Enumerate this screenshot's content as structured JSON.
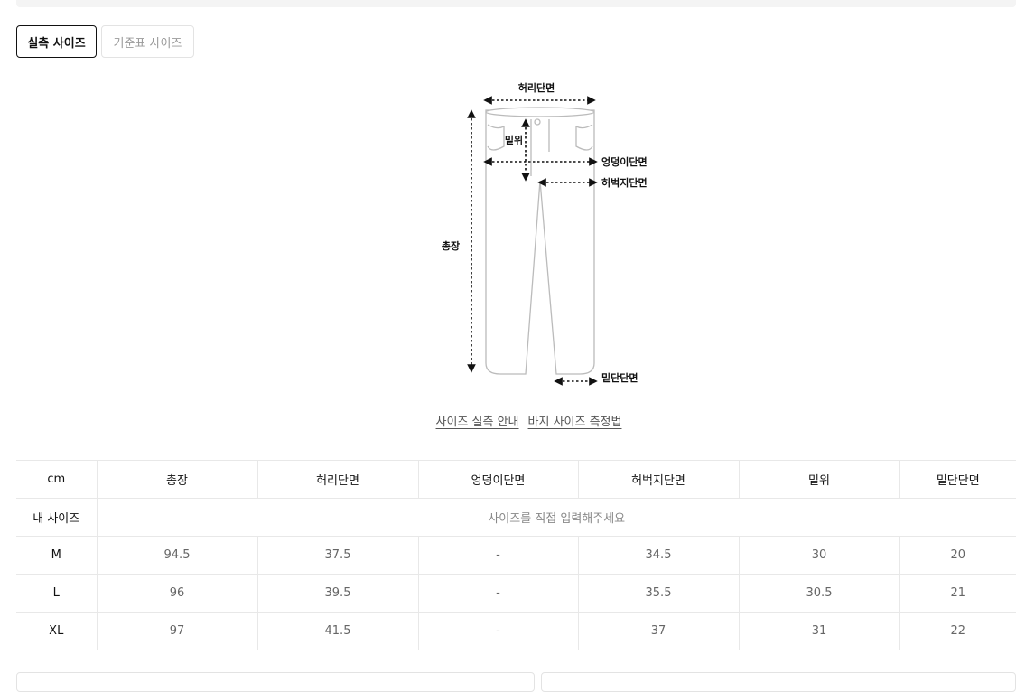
{
  "tabs": [
    {
      "label": "실측 사이즈",
      "active": true
    },
    {
      "label": "기준표 사이즈",
      "active": false
    }
  ],
  "diagram": {
    "labels": {
      "waist": "허리단면",
      "rise": "밑위",
      "hip": "엉덩이단면",
      "thigh": "허벅지단면",
      "length": "총장",
      "hem": "밑단단면"
    }
  },
  "links": {
    "size_guide": "사이즈 실측 안내",
    "pants_measure": "바지 사이즈 측정법"
  },
  "table": {
    "unit": "cm",
    "headers": [
      "총장",
      "허리단면",
      "엉덩이단면",
      "허벅지단면",
      "밑위",
      "밑단단면"
    ],
    "my_size": {
      "label": "내 사이즈",
      "hint": "사이즈를 직접 입력해주세요"
    },
    "rows": [
      {
        "size": "M",
        "values": [
          "94.5",
          "37.5",
          "-",
          "34.5",
          "30",
          "20"
        ]
      },
      {
        "size": "L",
        "values": [
          "96",
          "39.5",
          "-",
          "35.5",
          "30.5",
          "21"
        ]
      },
      {
        "size": "XL",
        "values": [
          "97",
          "41.5",
          "-",
          "37",
          "31",
          "22"
        ]
      }
    ]
  }
}
